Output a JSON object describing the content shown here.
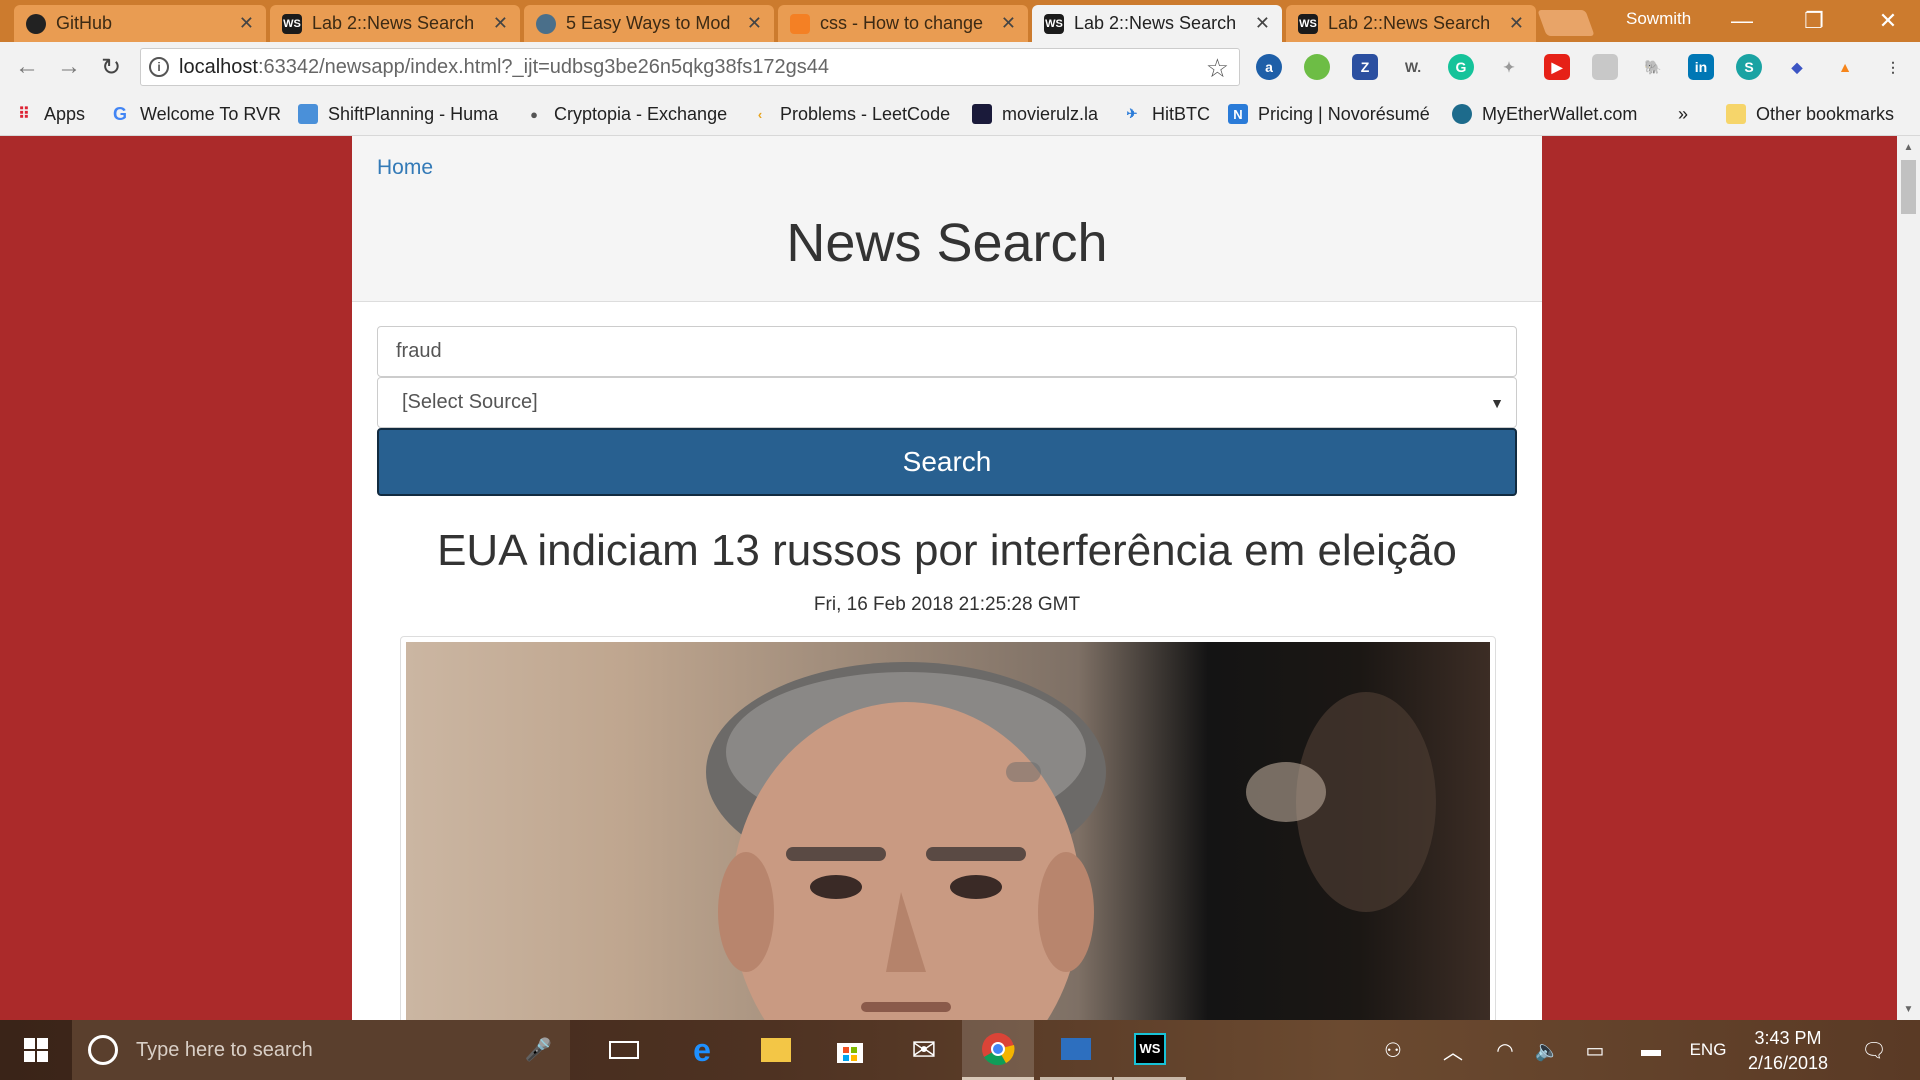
{
  "browser": {
    "tabs": [
      {
        "title": "GitHub",
        "icon": "github-icon",
        "active": false
      },
      {
        "title": "Lab 2::News Search",
        "icon": "webstorm-icon",
        "active": false
      },
      {
        "title": "5 Easy Ways to Mod",
        "icon": "site-icon",
        "active": false
      },
      {
        "title": "css - How to change",
        "icon": "stackoverflow-icon",
        "active": false
      },
      {
        "title": "Lab 2::News Search",
        "icon": "webstorm-icon",
        "active": true
      },
      {
        "title": "Lab 2::News Search",
        "icon": "webstorm-icon",
        "active": false
      }
    ],
    "profile_name": "Sowmith",
    "url_host": "localhost",
    "url_rest": ":63342/newsapp/index.html?_ijt=udbsg3be26n5qkg38fs172gs44",
    "bookmarks": [
      "Apps",
      "Welcome To RVR",
      "ShiftPlanning - Huma",
      "Cryptopia - Exchange",
      "Problems - LeetCode",
      "movierulz.la",
      "HitBTC",
      "Pricing | Novorésumé",
      "MyEtherWallet.com"
    ],
    "bookmarks_overflow": "»",
    "other_bookmarks": "Other bookmarks"
  },
  "page": {
    "home_link": "Home",
    "title": "News Search",
    "search_value": "fraud",
    "source_select": "[Select Source]",
    "search_button": "Search",
    "article": {
      "headline": "EUA indiciam 13 russos por interferência em eleição",
      "date": "Fri, 16 Feb 2018 21:25:28 GMT"
    }
  },
  "taskbar": {
    "search_placeholder": "Type here to search",
    "language": "ENG",
    "time": "3:43 PM",
    "date": "2/16/2018"
  },
  "colors": {
    "page_background": "#ab2a2a",
    "search_button": "#286090",
    "link": "#337ab7",
    "tab_strip": "#cc7b2e"
  }
}
